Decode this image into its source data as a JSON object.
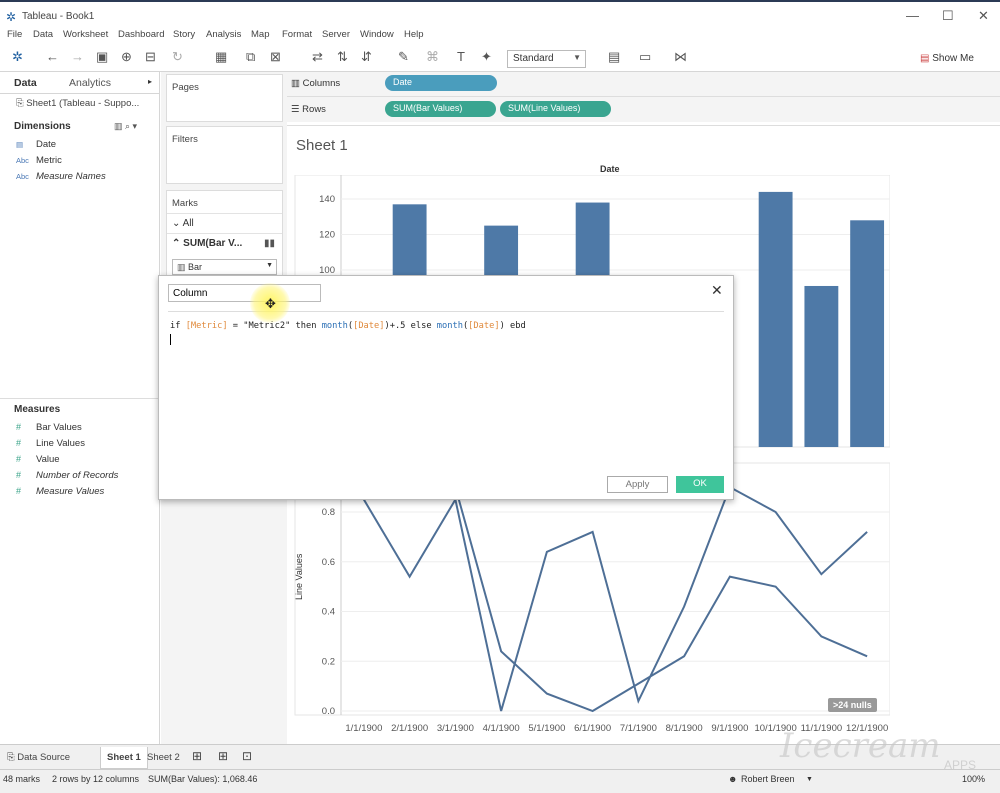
{
  "window": {
    "title": "Tableau - Book1",
    "minimize": "—",
    "maximize": "☐",
    "close": "✕"
  },
  "menu": [
    "File",
    "Data",
    "Worksheet",
    "Dashboard",
    "Story",
    "Analysis",
    "Map",
    "Format",
    "Server",
    "Window",
    "Help"
  ],
  "toolbar": {
    "view_size": "Standard",
    "show_me": "Show Me"
  },
  "data_pane": {
    "tab_data": "Data",
    "tab_analytics": "Analytics",
    "datasource": "Sheet1 (Tableau - Suppo...",
    "dimensions_header": "Dimensions",
    "dimensions": [
      {
        "icon": "calendar-icon",
        "type": "▤",
        "name": "Date",
        "italic": false
      },
      {
        "icon": "abc-icon",
        "type": "Abc",
        "name": "Metric",
        "italic": false
      },
      {
        "icon": "abc-icon",
        "type": "Abc",
        "name": "Measure Names",
        "italic": true
      }
    ],
    "measures_header": "Measures",
    "measures": [
      {
        "type": "#",
        "name": "Bar Values",
        "italic": false
      },
      {
        "type": "#",
        "name": "Line Values",
        "italic": false
      },
      {
        "type": "#",
        "name": "Value",
        "italic": false
      },
      {
        "type": "#",
        "name": "Number of Records",
        "italic": true
      },
      {
        "type": "#",
        "name": "Measure Values",
        "italic": true
      }
    ]
  },
  "cards": {
    "pages": "Pages",
    "filters": "Filters",
    "marks": "Marks",
    "marks_all": "All",
    "marks_sum": "SUM(Bar V...",
    "mark_type": "Bar"
  },
  "shelves": {
    "columns_label": "Columns",
    "rows_label": "Rows",
    "columns_pills": [
      "Date"
    ],
    "rows_pills": [
      "SUM(Bar Values)",
      "SUM(Line Values)"
    ]
  },
  "sheet": {
    "title": "Sheet 1",
    "column_header": "Date",
    "y2_label": "Line Values",
    "nulls_badge": ">24 nulls"
  },
  "chart_data": {
    "type": "bar",
    "title": "Sheet 1",
    "xlabel": "Date",
    "categories": [
      "1/1/1900",
      "2/1/1900",
      "3/1/1900",
      "4/1/1900",
      "5/1/1900",
      "6/1/1900",
      "7/1/1900",
      "8/1/1900",
      "9/1/1900",
      "10/1/1900",
      "11/1/1900",
      "12/1/1900"
    ],
    "bar_panel": {
      "ylabel": "",
      "yticks": [
        100,
        120,
        140
      ],
      "visible_bars": [
        {
          "category": "2/1/1900",
          "value": 137
        },
        {
          "category": "4/1/1900",
          "value": 125
        },
        {
          "category": "6/1/1900",
          "value": 138
        },
        {
          "category": "10/1/1900",
          "value": 144
        },
        {
          "category": "11/1/1900",
          "value": 91
        },
        {
          "category": "12/1/1900",
          "value": 128
        }
      ]
    },
    "line_panel": {
      "ylabel": "Line Values",
      "yticks": [
        0.0,
        0.2,
        0.4,
        0.6,
        0.8
      ],
      "ylim": [
        0.0,
        0.9
      ],
      "series": [
        {
          "values": [
            0.85,
            0.54,
            0.85,
            0.0,
            0.64,
            0.72,
            0.04,
            0.42,
            0.9,
            0.8,
            0.55,
            0.72
          ]
        },
        {
          "values": [
            0.9,
            0.9,
            0.9,
            0.24,
            0.07,
            0.0,
            0.11,
            0.22,
            0.54,
            0.5,
            0.3,
            0.22
          ]
        }
      ]
    }
  },
  "calc_dialog": {
    "name": "Column",
    "formula_tokens": [
      {
        "t": "if ",
        "c": "kw"
      },
      {
        "t": "[Metric]",
        "c": "fld"
      },
      {
        "t": " = \"Metric2\" then ",
        "c": "str"
      },
      {
        "t": "month",
        "c": "fn"
      },
      {
        "t": "(",
        "c": "kw"
      },
      {
        "t": "[Date]",
        "c": "fld"
      },
      {
        "t": ")+.5 else ",
        "c": "kw"
      },
      {
        "t": "month",
        "c": "fn"
      },
      {
        "t": "(",
        "c": "kw"
      },
      {
        "t": "[Date]",
        "c": "fld"
      },
      {
        "t": ") ebd",
        "c": "kw"
      }
    ],
    "apply": "Apply",
    "ok": "OK",
    "close": "✕"
  },
  "bottom_tabs": {
    "data_source": "Data Source",
    "sheets": [
      "Sheet 1",
      "Sheet 2"
    ]
  },
  "status": {
    "marks": "48 marks",
    "rows_cols": "2 rows by 12 columns",
    "sum": "SUM(Bar Values): 1,068.46",
    "user": "Robert Breen",
    "zoom": "100%"
  },
  "watermark": {
    "text": "Icecream",
    "sub": "APPS"
  },
  "colors": {
    "bar": "#4e79a7",
    "line": "#4e6f96",
    "accent_green": "#3aa590",
    "ok_button": "#3fc59b"
  }
}
